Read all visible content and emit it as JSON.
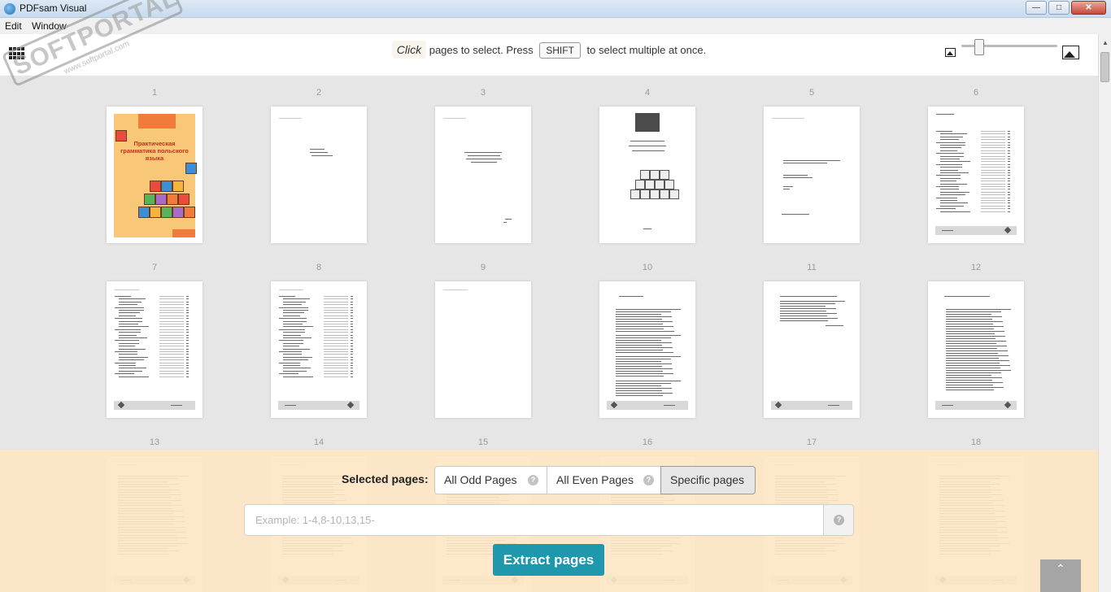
{
  "window": {
    "title": "PDFsam Visual",
    "minimize": "—",
    "maximize": "□",
    "close": "✕"
  },
  "menu": {
    "items": [
      "Edit",
      "Window"
    ]
  },
  "toolbar": {
    "grid_icon": "grid-view-icon",
    "hint_click": "Click",
    "hint_text_1": "pages to select. Press",
    "hint_key": "SHIFT",
    "hint_text_2": "to select multiple at once.",
    "zoom_small_icon": "image-small-icon",
    "zoom_large_icon": "image-large-icon",
    "zoom_level": 0.17
  },
  "pages": [
    "1",
    "2",
    "3",
    "4",
    "5",
    "6",
    "7",
    "8",
    "9",
    "10",
    "11",
    "12",
    "13",
    "14",
    "15",
    "16",
    "17",
    "18"
  ],
  "cover": {
    "title": "Практическая грамматика польского языка"
  },
  "selection": {
    "label": "Selected pages:",
    "options": [
      "All Odd Pages",
      "All Even Pages",
      "Specific pages"
    ],
    "active": "Specific pages",
    "help_glyph": "?",
    "input_placeholder": "Example: 1-4,8-10,13,15-",
    "input_value": "",
    "extract_label": "Extract pages",
    "scroll_top_glyph": "⌃"
  },
  "watermark": {
    "text": "SOFTPORTAL",
    "sub": "www.softportal.com",
    "mark": "TM"
  }
}
